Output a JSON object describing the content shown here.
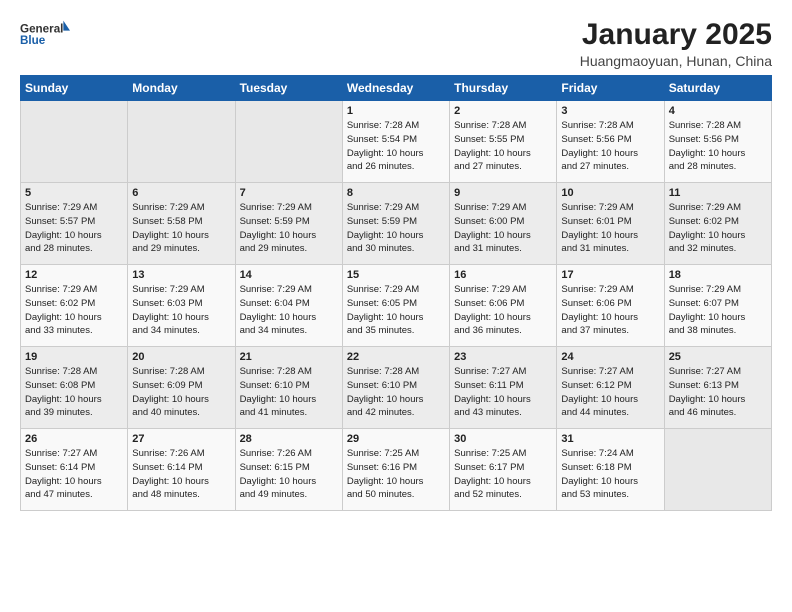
{
  "header": {
    "logo_general": "General",
    "logo_blue": "Blue",
    "title": "January 2025",
    "subtitle": "Huangmaoyuan, Hunan, China"
  },
  "days_of_week": [
    "Sunday",
    "Monday",
    "Tuesday",
    "Wednesday",
    "Thursday",
    "Friday",
    "Saturday"
  ],
  "weeks": [
    [
      {
        "day": "",
        "info": ""
      },
      {
        "day": "",
        "info": ""
      },
      {
        "day": "",
        "info": ""
      },
      {
        "day": "1",
        "info": "Sunrise: 7:28 AM\nSunset: 5:54 PM\nDaylight: 10 hours\nand 26 minutes."
      },
      {
        "day": "2",
        "info": "Sunrise: 7:28 AM\nSunset: 5:55 PM\nDaylight: 10 hours\nand 27 minutes."
      },
      {
        "day": "3",
        "info": "Sunrise: 7:28 AM\nSunset: 5:56 PM\nDaylight: 10 hours\nand 27 minutes."
      },
      {
        "day": "4",
        "info": "Sunrise: 7:28 AM\nSunset: 5:56 PM\nDaylight: 10 hours\nand 28 minutes."
      }
    ],
    [
      {
        "day": "5",
        "info": "Sunrise: 7:29 AM\nSunset: 5:57 PM\nDaylight: 10 hours\nand 28 minutes."
      },
      {
        "day": "6",
        "info": "Sunrise: 7:29 AM\nSunset: 5:58 PM\nDaylight: 10 hours\nand 29 minutes."
      },
      {
        "day": "7",
        "info": "Sunrise: 7:29 AM\nSunset: 5:59 PM\nDaylight: 10 hours\nand 29 minutes."
      },
      {
        "day": "8",
        "info": "Sunrise: 7:29 AM\nSunset: 5:59 PM\nDaylight: 10 hours\nand 30 minutes."
      },
      {
        "day": "9",
        "info": "Sunrise: 7:29 AM\nSunset: 6:00 PM\nDaylight: 10 hours\nand 31 minutes."
      },
      {
        "day": "10",
        "info": "Sunrise: 7:29 AM\nSunset: 6:01 PM\nDaylight: 10 hours\nand 31 minutes."
      },
      {
        "day": "11",
        "info": "Sunrise: 7:29 AM\nSunset: 6:02 PM\nDaylight: 10 hours\nand 32 minutes."
      }
    ],
    [
      {
        "day": "12",
        "info": "Sunrise: 7:29 AM\nSunset: 6:02 PM\nDaylight: 10 hours\nand 33 minutes."
      },
      {
        "day": "13",
        "info": "Sunrise: 7:29 AM\nSunset: 6:03 PM\nDaylight: 10 hours\nand 34 minutes."
      },
      {
        "day": "14",
        "info": "Sunrise: 7:29 AM\nSunset: 6:04 PM\nDaylight: 10 hours\nand 34 minutes."
      },
      {
        "day": "15",
        "info": "Sunrise: 7:29 AM\nSunset: 6:05 PM\nDaylight: 10 hours\nand 35 minutes."
      },
      {
        "day": "16",
        "info": "Sunrise: 7:29 AM\nSunset: 6:06 PM\nDaylight: 10 hours\nand 36 minutes."
      },
      {
        "day": "17",
        "info": "Sunrise: 7:29 AM\nSunset: 6:06 PM\nDaylight: 10 hours\nand 37 minutes."
      },
      {
        "day": "18",
        "info": "Sunrise: 7:29 AM\nSunset: 6:07 PM\nDaylight: 10 hours\nand 38 minutes."
      }
    ],
    [
      {
        "day": "19",
        "info": "Sunrise: 7:28 AM\nSunset: 6:08 PM\nDaylight: 10 hours\nand 39 minutes."
      },
      {
        "day": "20",
        "info": "Sunrise: 7:28 AM\nSunset: 6:09 PM\nDaylight: 10 hours\nand 40 minutes."
      },
      {
        "day": "21",
        "info": "Sunrise: 7:28 AM\nSunset: 6:10 PM\nDaylight: 10 hours\nand 41 minutes."
      },
      {
        "day": "22",
        "info": "Sunrise: 7:28 AM\nSunset: 6:10 PM\nDaylight: 10 hours\nand 42 minutes."
      },
      {
        "day": "23",
        "info": "Sunrise: 7:27 AM\nSunset: 6:11 PM\nDaylight: 10 hours\nand 43 minutes."
      },
      {
        "day": "24",
        "info": "Sunrise: 7:27 AM\nSunset: 6:12 PM\nDaylight: 10 hours\nand 44 minutes."
      },
      {
        "day": "25",
        "info": "Sunrise: 7:27 AM\nSunset: 6:13 PM\nDaylight: 10 hours\nand 46 minutes."
      }
    ],
    [
      {
        "day": "26",
        "info": "Sunrise: 7:27 AM\nSunset: 6:14 PM\nDaylight: 10 hours\nand 47 minutes."
      },
      {
        "day": "27",
        "info": "Sunrise: 7:26 AM\nSunset: 6:14 PM\nDaylight: 10 hours\nand 48 minutes."
      },
      {
        "day": "28",
        "info": "Sunrise: 7:26 AM\nSunset: 6:15 PM\nDaylight: 10 hours\nand 49 minutes."
      },
      {
        "day": "29",
        "info": "Sunrise: 7:25 AM\nSunset: 6:16 PM\nDaylight: 10 hours\nand 50 minutes."
      },
      {
        "day": "30",
        "info": "Sunrise: 7:25 AM\nSunset: 6:17 PM\nDaylight: 10 hours\nand 52 minutes."
      },
      {
        "day": "31",
        "info": "Sunrise: 7:24 AM\nSunset: 6:18 PM\nDaylight: 10 hours\nand 53 minutes."
      },
      {
        "day": "",
        "info": ""
      }
    ]
  ]
}
